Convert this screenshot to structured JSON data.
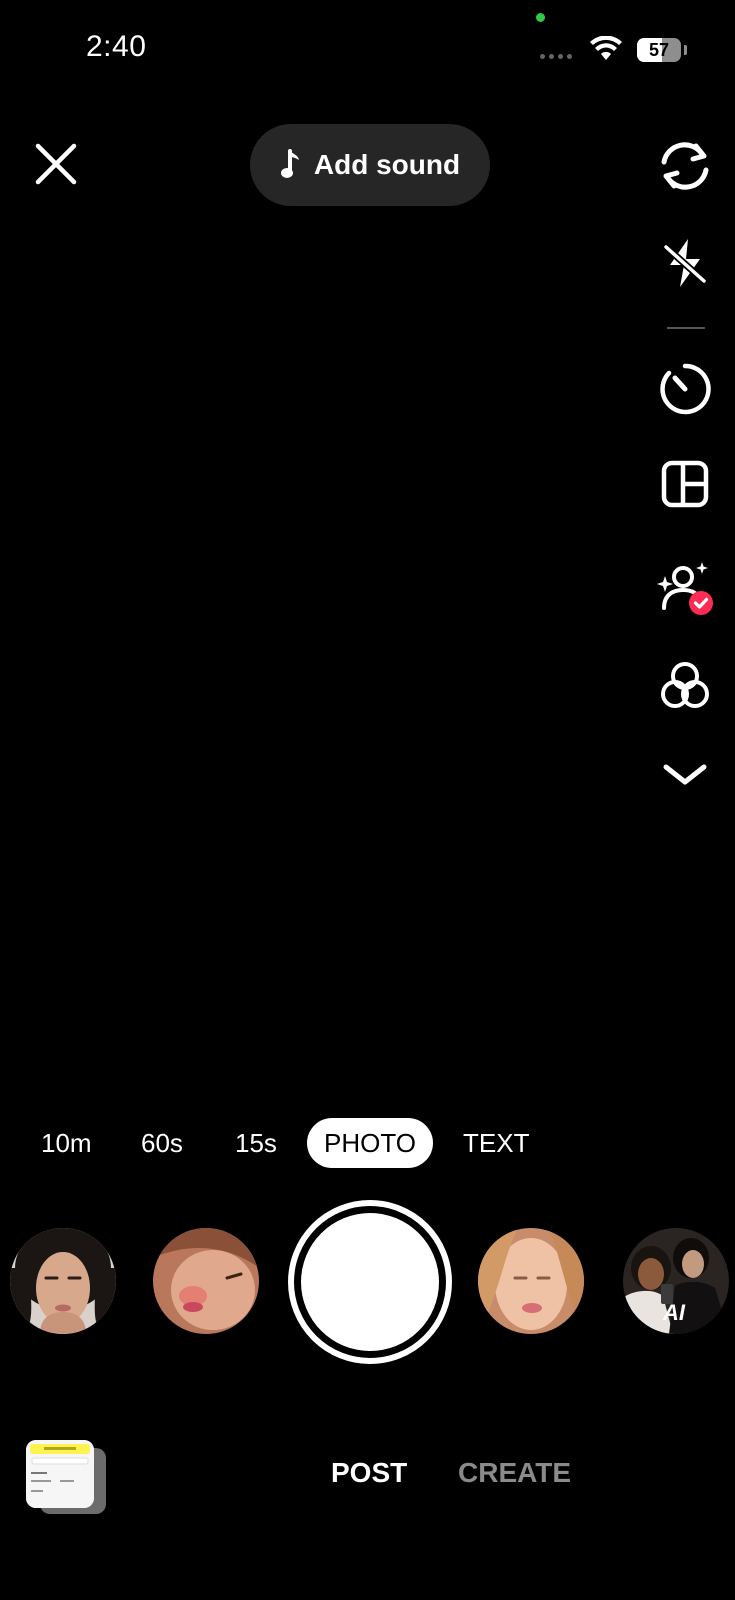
{
  "status_bar": {
    "time": "2:40",
    "battery": "57",
    "battery_level": 0.57
  },
  "top_bar": {
    "add_sound_label": "Add sound"
  },
  "right_rail": {
    "icons": [
      "flip-camera-icon",
      "flash-off-icon",
      "timer-icon",
      "layout-icon",
      "retouch-icon",
      "filters-icon",
      "chevron-down-icon"
    ]
  },
  "modes": {
    "items": [
      "10m",
      "60s",
      "15s",
      "PHOTO",
      "TEXT"
    ],
    "selected": "PHOTO"
  },
  "effects": {
    "ai_badge": "AI"
  },
  "bottom_tabs": {
    "post": "POST",
    "create": "CREATE"
  },
  "colors": {
    "background": "#000000",
    "accent_red": "#fe2c55",
    "pill": "#262626",
    "inactive_tab": "#8a8a8a"
  }
}
